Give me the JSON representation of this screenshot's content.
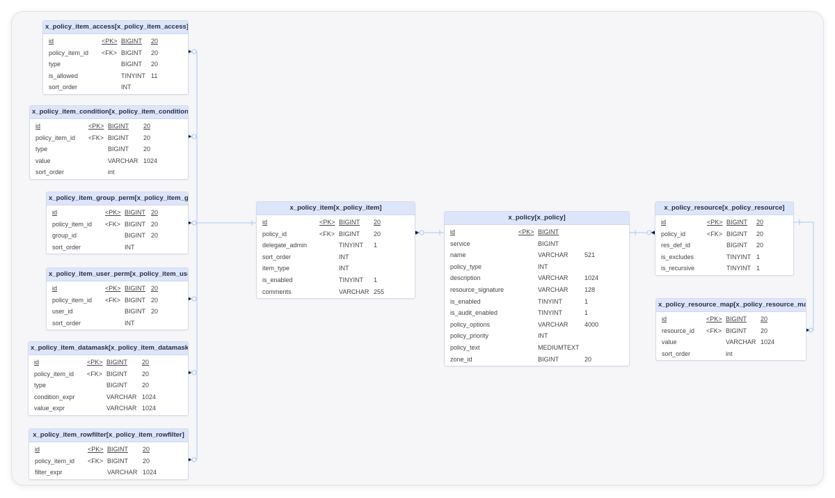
{
  "entities": [
    {
      "name": "x_policy_item_access[x_policy_item_access]",
      "columns": [
        {
          "name": "id",
          "key": "<PK>",
          "type": "BIGINT",
          "length": "20",
          "pk": true
        },
        {
          "name": "policy_item_id",
          "key": "<FK>",
          "type": "BIGINT",
          "length": "20"
        },
        {
          "name": "type",
          "key": "",
          "type": "BIGINT",
          "length": "20"
        },
        {
          "name": "is_allowed",
          "key": "",
          "type": "TINYINT",
          "length": "11"
        },
        {
          "name": "sort_order",
          "key": "",
          "type": "INT",
          "length": ""
        }
      ]
    },
    {
      "name": "x_policy_item_condition[x_policy_item_condition]",
      "columns": [
        {
          "name": "id",
          "key": "<PK>",
          "type": "BIGINT",
          "length": "20",
          "pk": true
        },
        {
          "name": "policy_item_id",
          "key": "<FK>",
          "type": "BIGINT",
          "length": "20"
        },
        {
          "name": "type",
          "key": "",
          "type": "BIGINT",
          "length": "20"
        },
        {
          "name": "value",
          "key": "",
          "type": "VARCHAR",
          "length": "1024"
        },
        {
          "name": "sort_order",
          "key": "",
          "type": "int",
          "length": ""
        }
      ]
    },
    {
      "name": "x_policy_item_group_perm[x_policy_item_group_perm]",
      "columns": [
        {
          "name": "id",
          "key": "<PK>",
          "type": "BIGINT",
          "length": "20",
          "pk": true
        },
        {
          "name": "policy_item_id",
          "key": "<FK>",
          "type": "BIGINT",
          "length": "20"
        },
        {
          "name": "group_id",
          "key": "",
          "type": "BIGINT",
          "length": "20"
        },
        {
          "name": "sort_order",
          "key": "",
          "type": "INT",
          "length": ""
        }
      ]
    },
    {
      "name": "x_policy_item_user_perm[x_policy_item_user_perm]",
      "columns": [
        {
          "name": "id",
          "key": "<PK>",
          "type": "BIGINT",
          "length": "20",
          "pk": true
        },
        {
          "name": "policy_item_id",
          "key": "<FK>",
          "type": "BIGINT",
          "length": "20"
        },
        {
          "name": "user_id",
          "key": "",
          "type": "BIGINT",
          "length": "20"
        },
        {
          "name": "sort_order",
          "key": "",
          "type": "INT",
          "length": ""
        }
      ]
    },
    {
      "name": "x_policy_item_datamask[x_policy_item_datamask]",
      "columns": [
        {
          "name": "id",
          "key": "<PK>",
          "type": "BIGINT",
          "length": "20",
          "pk": true
        },
        {
          "name": "policy_item_id",
          "key": "<FK>",
          "type": "BIGINT",
          "length": "20"
        },
        {
          "name": "type",
          "key": "",
          "type": "BIGINT",
          "length": "20"
        },
        {
          "name": "condition_expr",
          "key": "",
          "type": "VARCHAR",
          "length": "1024"
        },
        {
          "name": "value_expr",
          "key": "",
          "type": "VARCHAR",
          "length": "1024"
        }
      ]
    },
    {
      "name": "x_policy_item_rowfilter[x_policy_item_rowfilter]",
      "columns": [
        {
          "name": "id",
          "key": "<PK>",
          "type": "BIGINT",
          "length": "20",
          "pk": true
        },
        {
          "name": "policy_item_id",
          "key": "<FK>",
          "type": "BIGINT",
          "length": "20"
        },
        {
          "name": "filter_expr",
          "key": "",
          "type": "VARCHAR",
          "length": "1024"
        }
      ]
    },
    {
      "name": "x_policy_item[x_policy_item]",
      "columns": [
        {
          "name": "id",
          "key": "<PK>",
          "type": "BIGINT",
          "length": "20",
          "pk": true
        },
        {
          "name": "policy_id",
          "key": "<FK>",
          "type": "BIGINT",
          "length": "20"
        },
        {
          "name": "delegate_admin",
          "key": "",
          "type": "TINYINT",
          "length": "1"
        },
        {
          "name": "sort_order",
          "key": "",
          "type": "INT",
          "length": ""
        },
        {
          "name": "item_type",
          "key": "",
          "type": "INT",
          "length": ""
        },
        {
          "name": "is_enabled",
          "key": "",
          "type": "TINYINT",
          "length": "1"
        },
        {
          "name": "comments",
          "key": "",
          "type": "VARCHAR",
          "length": "255"
        }
      ]
    },
    {
      "name": "x_policy[x_policy]",
      "columns": [
        {
          "name": "id",
          "key": "<PK>",
          "type": "BIGINT",
          "length": "",
          "pk": true
        },
        {
          "name": "service",
          "key": "",
          "type": "BIGINT",
          "length": ""
        },
        {
          "name": "name",
          "key": "",
          "type": "VARCHAR",
          "length": "521"
        },
        {
          "name": "policy_type",
          "key": "",
          "type": "INT",
          "length": ""
        },
        {
          "name": "description",
          "key": "",
          "type": "VARCHAR",
          "length": "1024"
        },
        {
          "name": "resource_signature",
          "key": "",
          "type": "VARCHAR",
          "length": "128"
        },
        {
          "name": "is_enabled",
          "key": "",
          "type": "TINYINT",
          "length": "1"
        },
        {
          "name": "is_audit_enabled",
          "key": "",
          "type": "TINYINT",
          "length": "1"
        },
        {
          "name": "policy_options",
          "key": "",
          "type": "VARCHAR",
          "length": "4000"
        },
        {
          "name": "policy_priority",
          "key": "",
          "type": "INT",
          "length": ""
        },
        {
          "name": "policy_text",
          "key": "",
          "type": "MEDIUMTEXT",
          "length": ""
        },
        {
          "name": "zone_id",
          "key": "",
          "type": "BIGINT",
          "length": "20"
        }
      ]
    },
    {
      "name": "x_policy_resource[x_policy_resource]",
      "columns": [
        {
          "name": "id",
          "key": "<PK>",
          "type": "BIGINT",
          "length": "20",
          "pk": true
        },
        {
          "name": "policy_id",
          "key": "<FK>",
          "type": "BIGINT",
          "length": "20"
        },
        {
          "name": "res_def_id",
          "key": "",
          "type": "BIGINT",
          "length": "20"
        },
        {
          "name": "is_excludes",
          "key": "",
          "type": "TINYINT",
          "length": "1"
        },
        {
          "name": "is_recursive",
          "key": "",
          "type": "TINYINT",
          "length": "1"
        }
      ]
    },
    {
      "name": "x_policy_resource_map[x_policy_resource_map]",
      "columns": [
        {
          "name": "id",
          "key": "<PK>",
          "type": "BIGINT",
          "length": "20",
          "pk": true
        },
        {
          "name": "resource_id",
          "key": "<FK>",
          "type": "BIGINT",
          "length": "20"
        },
        {
          "name": "value",
          "key": "",
          "type": "VARCHAR",
          "length": "1024"
        },
        {
          "name": "sort_order",
          "key": "",
          "type": "int",
          "length": ""
        }
      ]
    }
  ],
  "colors": {
    "header_bg": "#dde5fb",
    "connector": "#a9c8ee",
    "canvas_bg": "#f6f6f8"
  }
}
